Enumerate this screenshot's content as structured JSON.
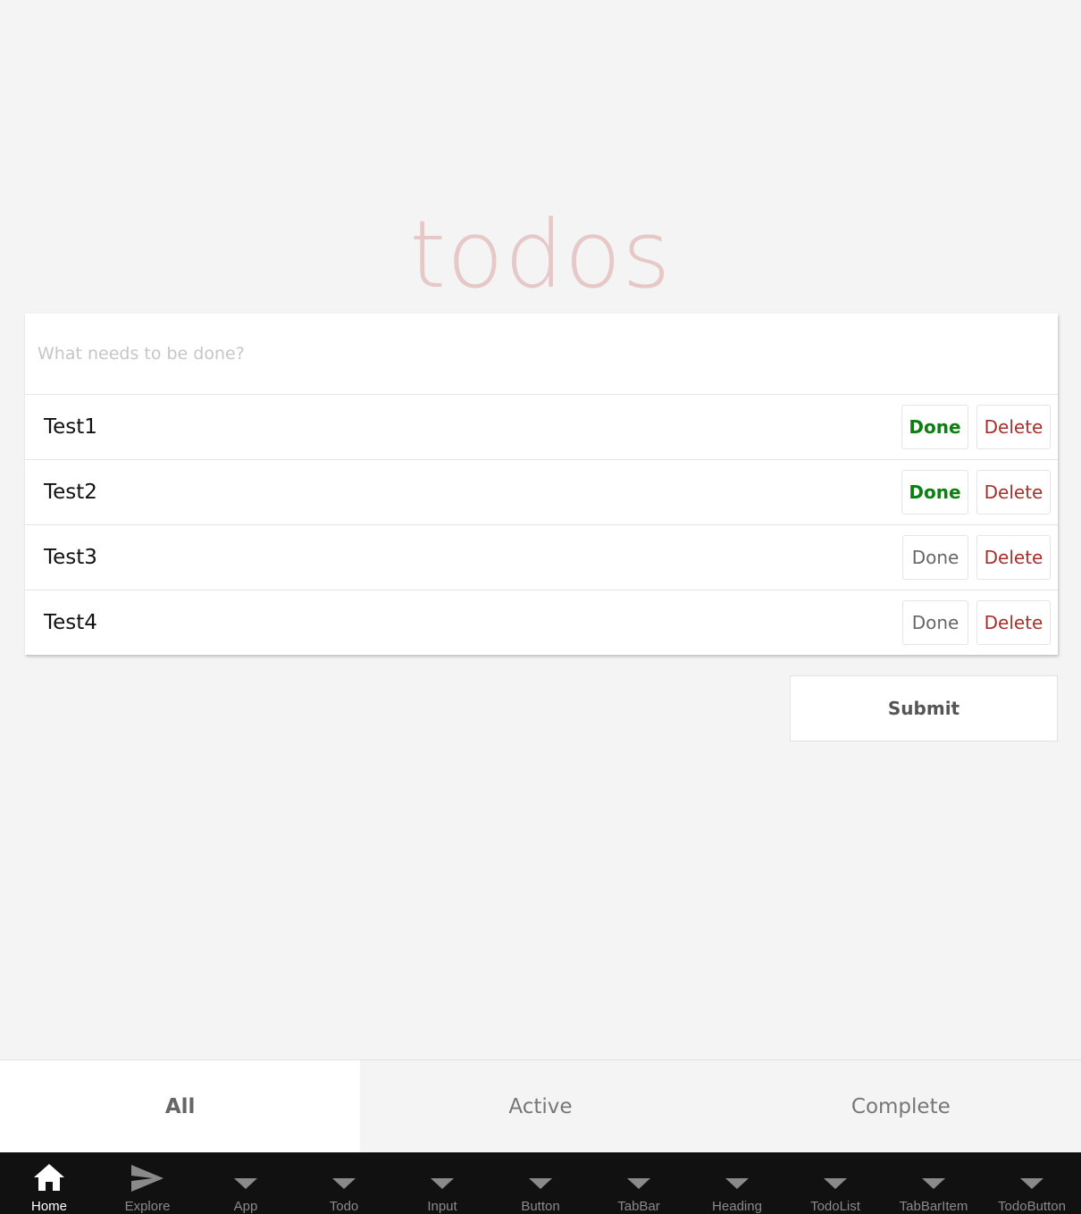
{
  "header": {
    "title": "todos"
  },
  "input": {
    "placeholder": "What needs to be done?",
    "value": ""
  },
  "todos": [
    {
      "text": "Test1",
      "done": true,
      "done_label": "Done",
      "delete_label": "Delete"
    },
    {
      "text": "Test2",
      "done": true,
      "done_label": "Done",
      "delete_label": "Delete"
    },
    {
      "text": "Test3",
      "done": false,
      "done_label": "Done",
      "delete_label": "Delete"
    },
    {
      "text": "Test4",
      "done": false,
      "done_label": "Done",
      "delete_label": "Delete"
    }
  ],
  "submit_label": "Submit",
  "filters": [
    {
      "label": "All",
      "active": true
    },
    {
      "label": "Active",
      "active": false
    },
    {
      "label": "Complete",
      "active": false
    }
  ],
  "nav": [
    {
      "label": "Home",
      "icon": "home-icon",
      "active": true
    },
    {
      "label": "Explore",
      "icon": "send-icon",
      "active": false
    },
    {
      "label": "App",
      "icon": "triangle-down-icon",
      "active": false
    },
    {
      "label": "Todo",
      "icon": "triangle-down-icon",
      "active": false
    },
    {
      "label": "Input",
      "icon": "triangle-down-icon",
      "active": false
    },
    {
      "label": "Button",
      "icon": "triangle-down-icon",
      "active": false
    },
    {
      "label": "TabBar",
      "icon": "triangle-down-icon",
      "active": false
    },
    {
      "label": "Heading",
      "icon": "triangle-down-icon",
      "active": false
    },
    {
      "label": "TodoList",
      "icon": "triangle-down-icon",
      "active": false
    },
    {
      "label": "TabBarItem",
      "icon": "triangle-down-icon",
      "active": false
    },
    {
      "label": "TodoButton",
      "icon": "triangle-down-icon",
      "active": false
    }
  ],
  "colors": {
    "title": "#e6c8c8",
    "done_active": "#0a8010",
    "delete": "#a6302c",
    "nav_background": "#111111"
  }
}
